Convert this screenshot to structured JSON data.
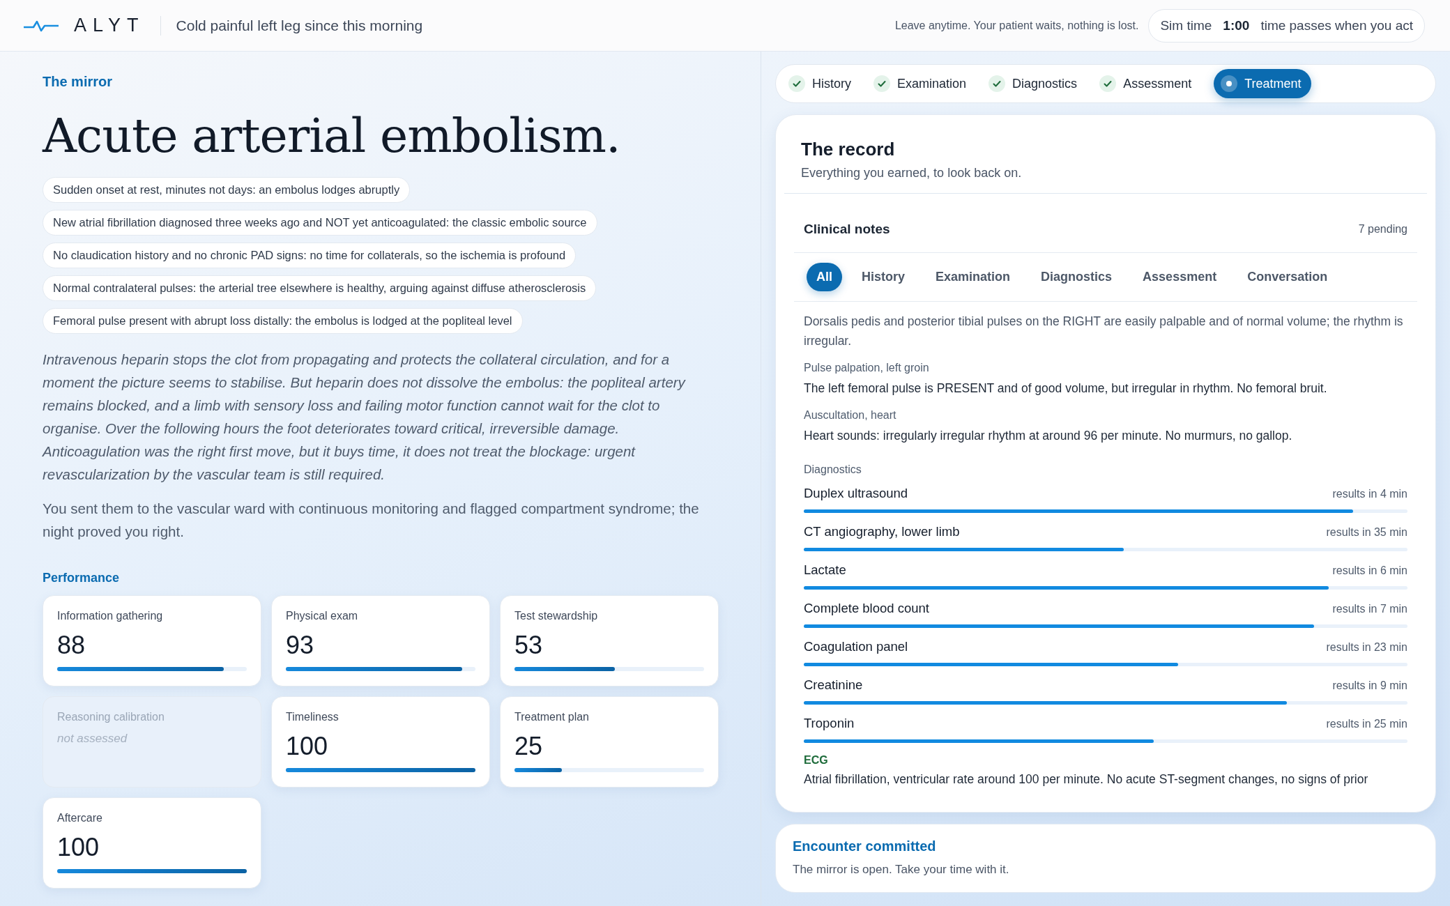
{
  "header": {
    "logo": "ALYT",
    "case_title": "Cold painful left leg since this morning",
    "leave_note": "Leave anytime. Your patient waits, nothing is lost.",
    "sim_time": {
      "label": "Sim time",
      "value": "1:00",
      "hint": "time passes when you act"
    }
  },
  "mirror": {
    "eyebrow": "The mirror",
    "diagnosis": "Acute arterial embolism.",
    "clues": [
      "Sudden onset at rest, minutes not days: an embolus lodges abruptly",
      "New atrial fibrillation diagnosed three weeks ago and NOT yet anticoagulated: the classic embolic source",
      "No claudication history and no chronic PAD signs: no time for collaterals, so the ischemia is profound",
      "Normal contralateral pulses: the arterial tree elsewhere is healthy, arguing against diffuse atherosclerosis",
      "Femoral pulse present with abrupt loss distally: the embolus is lodged at the popliteal level"
    ],
    "narrative": "Intravenous heparin stops the clot from propagating and protects the collateral circulation, and for a moment the picture seems to stabilise. But heparin does not dissolve the embolus: the popliteal artery remains blocked, and a limb with sensory loss and failing motor function cannot wait for the clot to organise. Over the following hours the foot deteriorates toward critical, irreversible damage. Anticoagulation was the right first move, but it buys time, it does not treat the blockage: urgent revascularization by the vascular team is still required.",
    "outcome": "You sent them to the vascular ward with continuous monitoring and flagged compartment syndrome; the night proved you right.",
    "performance_title": "Performance",
    "scores": [
      {
        "kind": "score",
        "label": "Information gathering",
        "value": "88",
        "level": 0.88
      },
      {
        "kind": "score",
        "label": "Physical exam",
        "value": "93",
        "level": 0.93
      },
      {
        "kind": "score",
        "label": "Test stewardship",
        "value": "53",
        "level": 0.53
      },
      {
        "kind": "unassessed",
        "label": "Reasoning calibration",
        "value": "not assessed"
      },
      {
        "kind": "score",
        "label": "Timeliness",
        "value": "100",
        "level": 1
      },
      {
        "kind": "score",
        "label": "Treatment plan",
        "value": "25",
        "level": 0.25
      },
      {
        "kind": "score",
        "label": "Aftercare",
        "value": "100",
        "level": 1
      }
    ]
  },
  "steps": [
    {
      "label": "History",
      "done": true,
      "selected": false
    },
    {
      "label": "Examination",
      "done": true,
      "selected": false
    },
    {
      "label": "Diagnostics",
      "done": true,
      "selected": false
    },
    {
      "label": "Assessment",
      "done": true,
      "selected": false
    },
    {
      "label": "Treatment",
      "done": false,
      "selected": true
    }
  ],
  "record": {
    "title": "The record",
    "subtitle": "Everything you earned, to look back on.",
    "notes": {
      "title": "Clinical notes",
      "pending": "7 pending",
      "tabs": [
        {
          "label": "All",
          "selected": true
        },
        {
          "label": "History",
          "selected": false
        },
        {
          "label": "Examination",
          "selected": false
        },
        {
          "label": "Diagnostics",
          "selected": false
        },
        {
          "label": "Assessment",
          "selected": false
        },
        {
          "label": "Conversation",
          "selected": false
        }
      ],
      "exam_notes": [
        {
          "text": "Dorsalis pedis and posterior tibial pulses on the RIGHT are easily palpable and of normal volume; the rhythm is irregular."
        },
        {
          "label": "Pulse palpation, left groin",
          "text": "The left femoral pulse is PRESENT and of good volume, but irregular in rhythm. No femoral bruit."
        },
        {
          "label": "Auscultation, heart",
          "text": "Heart sounds: irregularly irregular rhythm at around 96 per minute. No murmurs, no gallop."
        }
      ],
      "diagnostics_title": "Diagnostics",
      "tests": [
        {
          "name": "Duplex ultrasound",
          "eta": "results in 4 min",
          "level": 0.91
        },
        {
          "name": "CT angiography, lower limb",
          "eta": "results in 35 min",
          "level": 0.53
        },
        {
          "name": "Lactate",
          "eta": "results in 6 min",
          "level": 0.87
        },
        {
          "name": "Complete blood count",
          "eta": "results in 7 min",
          "level": 0.845
        },
        {
          "name": "Coagulation panel",
          "eta": "results in 23 min",
          "level": 0.62
        },
        {
          "name": "Creatinine",
          "eta": "results in 9 min",
          "level": 0.8
        },
        {
          "name": "Troponin",
          "eta": "results in 25 min",
          "level": 0.58
        }
      ],
      "ecg": {
        "label": "ECG",
        "text": "Atrial fibrillation, ventricular rate around 100 per minute. No acute ST-segment changes, no signs of prior"
      }
    }
  },
  "committed": {
    "title": "Encounter committed",
    "text": "The mirror is open. Take your time with it."
  }
}
